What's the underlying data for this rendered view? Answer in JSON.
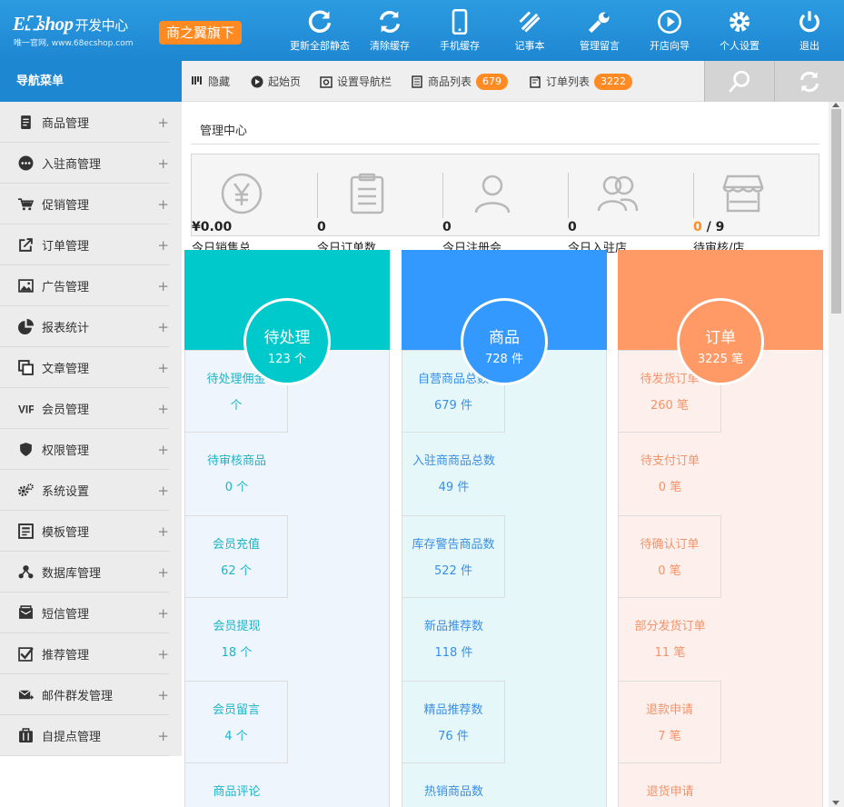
{
  "header": {
    "logo": "E⛶shop",
    "logo_cn": "开发中心",
    "logo_sub": "唯一官网, www.68ecshop.com",
    "flag": "商之翼旗下",
    "buttons": [
      {
        "label": "更新全部静态",
        "icon": "refresh-icon"
      },
      {
        "label": "清除缓存",
        "icon": "clear-cache-icon"
      },
      {
        "label": "手机缓存",
        "icon": "mobile-icon"
      },
      {
        "label": "记事本",
        "icon": "notepad-icon"
      },
      {
        "label": "管理留言",
        "icon": "wrench-icon"
      },
      {
        "label": "开店向导",
        "icon": "play-icon"
      },
      {
        "label": "个人设置",
        "icon": "gear-icon"
      },
      {
        "label": "退出",
        "icon": "power-icon"
      }
    ]
  },
  "sidebar": {
    "title": "导航菜单",
    "items": [
      {
        "label": "商品管理",
        "icon": "goods-icon"
      },
      {
        "label": "入驻商管理",
        "icon": "dots-icon"
      },
      {
        "label": "促销管理",
        "icon": "cart-icon"
      },
      {
        "label": "订单管理",
        "icon": "export-icon"
      },
      {
        "label": "广告管理",
        "icon": "image-icon"
      },
      {
        "label": "报表统计",
        "icon": "pie-icon"
      },
      {
        "label": "文章管理",
        "icon": "copy-icon"
      },
      {
        "label": "会员管理",
        "icon": "vip-icon"
      },
      {
        "label": "权限管理",
        "icon": "shield-icon"
      },
      {
        "label": "系统设置",
        "icon": "gears-icon"
      },
      {
        "label": "模板管理",
        "icon": "template-icon"
      },
      {
        "label": "数据库管理",
        "icon": "database-icon"
      },
      {
        "label": "短信管理",
        "icon": "sms-icon"
      },
      {
        "label": "推荐管理",
        "icon": "check-icon"
      },
      {
        "label": "邮件群发管理",
        "icon": "mail-icon"
      },
      {
        "label": "自提点管理",
        "icon": "pickup-icon"
      }
    ],
    "plus": "+"
  },
  "toolbar": {
    "hide": "隐藏",
    "home": "起始页",
    "setnav": "设置导航栏",
    "goods_list": "商品列表",
    "goods_count": "679",
    "order_list": "订单列表",
    "order_count": "3222"
  },
  "main": {
    "breadcrumb": "管理中心",
    "stats": [
      {
        "value": "¥0.00",
        "label": "今日销售总",
        "icon": "yen-icon"
      },
      {
        "value": "0",
        "label": "今日订单数",
        "icon": "clipboard-icon"
      },
      {
        "value": "0",
        "label": "今日注册会",
        "icon": "user-icon"
      },
      {
        "value": "0",
        "label": "今日入驻店",
        "icon": "users-icon"
      },
      {
        "value_hl": "0",
        "value_rest": " / 9",
        "label": "待审核/店",
        "icon": "store-icon"
      }
    ],
    "columns": [
      {
        "title": "待处理",
        "count": "123 个",
        "color": "#00c9cb",
        "bg": "#eef5fd",
        "text_color": "#1ab6c6",
        "cells": [
          {
            "label": "待处理佣金",
            "value": "个"
          },
          {
            "label": "待审核商品",
            "value": "0 个"
          },
          {
            "label": "会员充值",
            "value": "62 个"
          },
          {
            "label": "会员提现",
            "value": "18 个"
          },
          {
            "label": "会员留言",
            "value": "4 个"
          },
          {
            "label": "商品评论",
            "value": ""
          }
        ]
      },
      {
        "title": "商品",
        "count": "728 件",
        "color": "#3399ff",
        "bg": "#e5f7f9",
        "text_color": "#3a8ee6",
        "cells": [
          {
            "label": "自营商品总数",
            "value": "679 件"
          },
          {
            "label": "入驻商商品总数",
            "value": "49 件"
          },
          {
            "label": "库存警告商品数",
            "value": "522 件"
          },
          {
            "label": "新品推荐数",
            "value": "118 件"
          },
          {
            "label": "精品推荐数",
            "value": "76 件"
          },
          {
            "label": "热销商品数",
            "value": ""
          }
        ]
      },
      {
        "title": "订单",
        "count": "3225 笔",
        "color": "#ff9966",
        "bg": "#fdefeb",
        "text_color": "#f3936a",
        "cells": [
          {
            "label": "待发货订单",
            "value": "260 笔"
          },
          {
            "label": "待支付订单",
            "value": "0 笔"
          },
          {
            "label": "待确认订单",
            "value": "0 笔"
          },
          {
            "label": "部分发货订单",
            "value": "11 笔"
          },
          {
            "label": "退款申请",
            "value": "7 笔"
          },
          {
            "label": "退货申请",
            "value": ""
          }
        ]
      }
    ]
  }
}
